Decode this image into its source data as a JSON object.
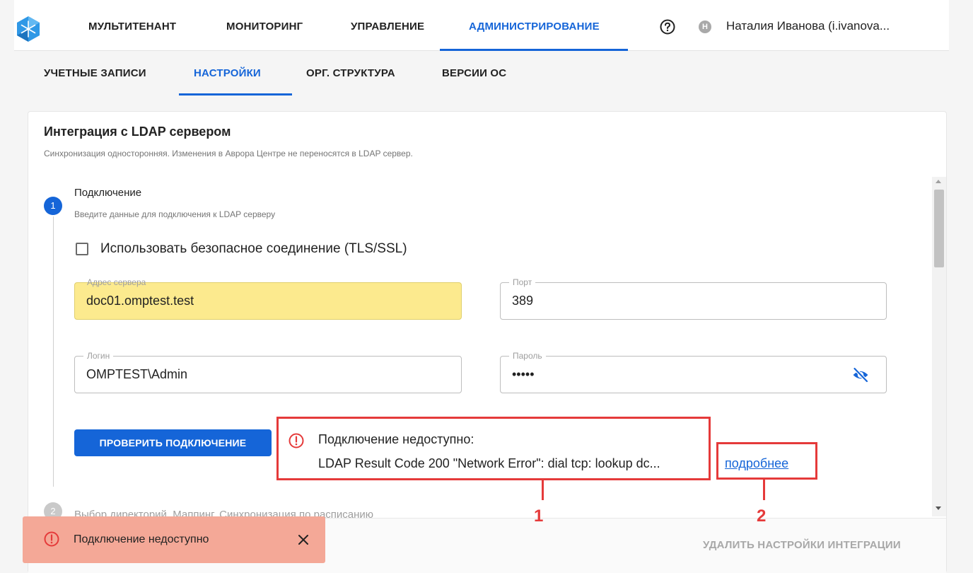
{
  "header": {
    "nav": [
      "МУЛЬТИТЕНАНТ",
      "МОНИТОРИНГ",
      "УПРАВЛЕНИЕ",
      "АДМИНИСТРИРОВАНИЕ"
    ],
    "user": {
      "initial": "Н",
      "name": "Наталия Иванова (i.ivanova..."
    }
  },
  "subtabs": [
    "УЧЕТНЫЕ ЗАПИСИ",
    "НАСТРОЙКИ",
    "ОРГ. СТРУКТУРА",
    "ВЕРСИИ ОС"
  ],
  "card": {
    "title": "Интеграция с LDAP сервером",
    "subtitle": "Синхронизация односторонняя. Изменения в Аврора Центре не переносятся в LDAP сервер."
  },
  "step1": {
    "number": "1",
    "title": "Подключение",
    "description": "Введите данные для подключения к LDAP серверу",
    "checkbox_label": "Использовать безопасное соединение (TLS/SSL)",
    "fields": {
      "server": {
        "label": "Адрес сервера",
        "value": "doc01.omptest.test"
      },
      "port": {
        "label": "Порт",
        "value": "389"
      },
      "login": {
        "label": "Логин",
        "value": "OMPTEST\\Admin"
      },
      "password": {
        "label": "Пароль",
        "value": "•••••"
      }
    },
    "check_button": "ПРОВЕРИТЬ ПОДКЛЮЧЕНИЕ",
    "error": {
      "line1": "Подключение недоступно:",
      "line2": "LDAP Result Code 200 \"Network Error\": dial tcp: lookup dc...",
      "more_link": "подробнее"
    }
  },
  "step2": {
    "number": "2",
    "title": "Выбор директорий. Маппинг. Синхронизация по расписанию"
  },
  "footer": {
    "delete_button": "УДАЛИТЬ НАСТРОЙКИ ИНТЕГРАЦИИ"
  },
  "toast": {
    "text": "Подключение недоступно"
  },
  "callouts": [
    "1",
    "2"
  ],
  "colors": {
    "accent": "#1565d8",
    "error": "#e53a3a",
    "autofill": "#fcea8e",
    "toast": "#f4a897"
  }
}
